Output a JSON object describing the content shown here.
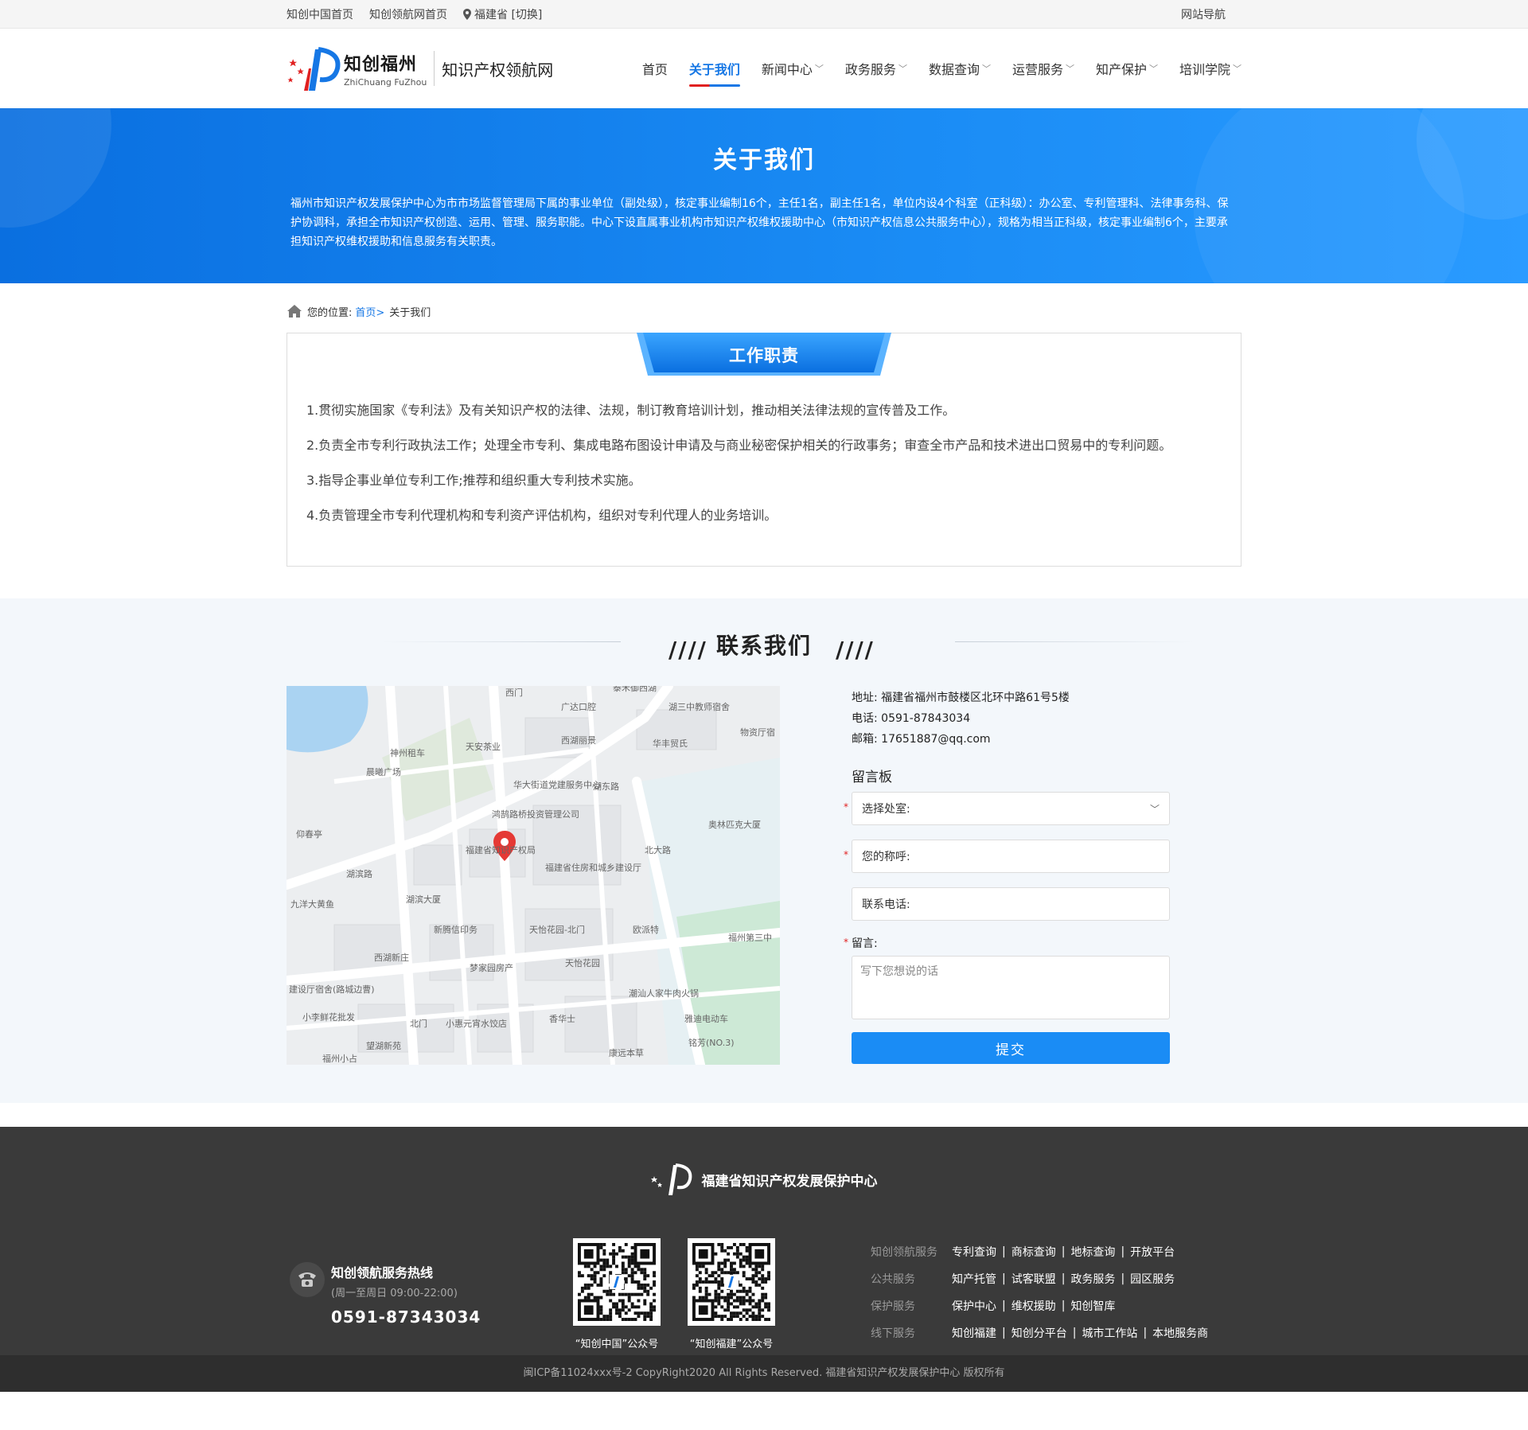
{
  "topbar": {
    "links": [
      "知创中国首页",
      "知创领航网首页"
    ],
    "location": "福建省 [切换]",
    "site_nav": "网站导航"
  },
  "header": {
    "logo_cn": "知创福州",
    "logo_en": "ZhiChuang FuZhou",
    "logo_sub": "知识产权领航网",
    "nav": [
      {
        "label": "首页",
        "dropdown": false
      },
      {
        "label": "关于我们",
        "dropdown": false,
        "active": true
      },
      {
        "label": "新闻中心",
        "dropdown": true
      },
      {
        "label": "政务服务",
        "dropdown": true
      },
      {
        "label": "数据查询",
        "dropdown": true
      },
      {
        "label": "运营服务",
        "dropdown": true
      },
      {
        "label": "知产保护",
        "dropdown": true
      },
      {
        "label": "培训学院",
        "dropdown": true
      }
    ]
  },
  "banner": {
    "title": "关于我们",
    "desc": "福州市知识产权发展保护中心为市市场监督管理局下属的事业单位（副处级），核定事业编制16个，主任1名，副主任1名，单位内设4个科室（正科级）：办公室、专利管理科、法律事务科、保护协调科，承担全市知识产权创造、运用、管理、服务职能。中心下设直属事业机构市知识产权维权援助中心（市知识产权信息公共服务中心），规格为相当正科级，核定事业编制6个，主要承担知识产权维权援助和信息服务有关职责。"
  },
  "breadcrumb": {
    "prefix": "您的位置:",
    "home": "首页>",
    "current": "关于我们"
  },
  "duties": {
    "title": "工作职责",
    "items": [
      "1.贯彻实施国家《专利法》及有关知识产权的法律、法规，制订教育培训计划，推动相关法律法规的宣传普及工作。",
      "2.负责全市专利行政执法工作；处理全市专利、集成电路布图设计申请及与商业秘密保护相关的行政事务；审查全市产品和技术进出口贸易中的专利问题。",
      "3.指导企事业单位专利工作;推荐和组织重大专利技术实施。",
      "4.负责管理全市专利代理机构和专利资产评估机构，组织对专利代理人的业务培训。"
    ]
  },
  "contact": {
    "title": "联系我们",
    "address": "地址:  福建省福州市鼓楼区北环中路61号5楼",
    "phone": "电话:  0591-87843034",
    "email": "邮箱:  17651887@qq.com",
    "board_title": "留言板",
    "dept_placeholder": "选择处室:",
    "name_placeholder": "您的称呼:",
    "tel_placeholder": "联系电话:",
    "msg_label": "留言:",
    "msg_placeholder": "写下您想说的话",
    "submit": "提交",
    "map_labels": [
      "西门",
      "广达口腔",
      "泰禾御西湖",
      "湖三中教师宿舍",
      "物资厅宿",
      "神州租车",
      "天安茶业",
      "西湖丽景",
      "华丰贸氏",
      "晨曦广场",
      "华大街道党建服务中心",
      "湖东路",
      "仰春亭",
      "鸿鹄路桥投资管理公司",
      "奥林匹克大厦",
      "福建省知识产权局",
      "福建省住房和城乡建设厅",
      "北大路",
      "湖滨路",
      "九洋大黄鱼",
      "湖滨大厦",
      "新腾信印务",
      "天怡花园-北门",
      "欧派特",
      "福州第三中",
      "西湖新庄",
      "梦家园房产",
      "天怡花园",
      "建设厅宿舍(路城边曹)",
      "潮汕人家牛肉火锅",
      "小李鲜花批发",
      "北门",
      "小惠元宵水饺店",
      "香华士",
      "雅迪电动车",
      "望湖新苑",
      "康远本草",
      "铭芳(NO.3)",
      "福州小占"
    ]
  },
  "footer": {
    "org_name": "福建省知识产权发展保护中心",
    "hotline_title": "知创领航服务热线",
    "hotline_hours": "(周一至周日 09:00-22:00)",
    "hotline_number": "0591-87343034",
    "qr_captions": [
      "“知创中国”公众号",
      "“知创福建”公众号"
    ],
    "link_groups": [
      {
        "category": "知创领航服务",
        "items": [
          "专利查询",
          "商标查询",
          "地标查询",
          "开放平台"
        ]
      },
      {
        "category": "公共服务",
        "items": [
          "知产托管",
          "试客联盟",
          "政务服务",
          "园区服务"
        ]
      },
      {
        "category": "保护服务",
        "items": [
          "保护中心",
          "维权援助",
          "知创智库"
        ]
      },
      {
        "category": "线下服务",
        "items": [
          "知创福建",
          "知创分平台",
          "城市工作站",
          "本地服务商"
        ]
      }
    ],
    "copyright": "闽ICP备11024xxx号-2  CopyRight2020  All Rights Reserved.  福建省知识产权发展保护中心  版权所有"
  },
  "colors": {
    "brand_blue": "#1677e5",
    "banner_blue": "#1a8cf5",
    "accent_red": "#e02020",
    "footer_dark": "#3a3a3a"
  }
}
